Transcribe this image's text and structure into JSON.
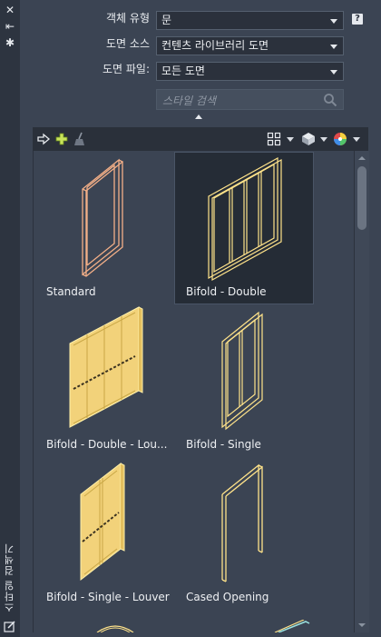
{
  "side": {
    "close_glyph": "✕",
    "pin_glyph": "⇤",
    "settings_glyph": "✱",
    "title": "스타일 검색기"
  },
  "form": {
    "object_type": {
      "label": "객체 유형",
      "value": "문"
    },
    "drawing_source": {
      "label": "도면 소스",
      "value": "컨텐츠 라이브러리 도면"
    },
    "drawing_file": {
      "label": "도면 파일:",
      "value": "모든 도면"
    },
    "help_glyph": "?",
    "search": {
      "placeholder": "스타일 검색",
      "value": ""
    }
  },
  "toolbar": {
    "icons": [
      "import-icon",
      "add-icon",
      "purge-icon",
      "view-mode-icon",
      "display-icon",
      "color-wheel-icon"
    ]
  },
  "gallery": {
    "selected_index": 1,
    "items": [
      {
        "label": "Standard",
        "kind": "single-frame"
      },
      {
        "label": "Bifold - Double",
        "kind": "bifold-double"
      },
      {
        "label": "Bifold - Double - Lou...",
        "kind": "bifold-double-louver"
      },
      {
        "label": "Bifold - Single",
        "kind": "bifold-single"
      },
      {
        "label": "Bifold - Single - Louver",
        "kind": "bifold-single-louver"
      },
      {
        "label": "Cased Opening",
        "kind": "cased-opening"
      }
    ]
  },
  "colors": {
    "panel_bg": "#3b4453",
    "sidebar_bg": "#2d3440",
    "door_fill": "#f2d27a",
    "door_stroke": "#ffe38a",
    "standard_door": "#f4b088"
  }
}
